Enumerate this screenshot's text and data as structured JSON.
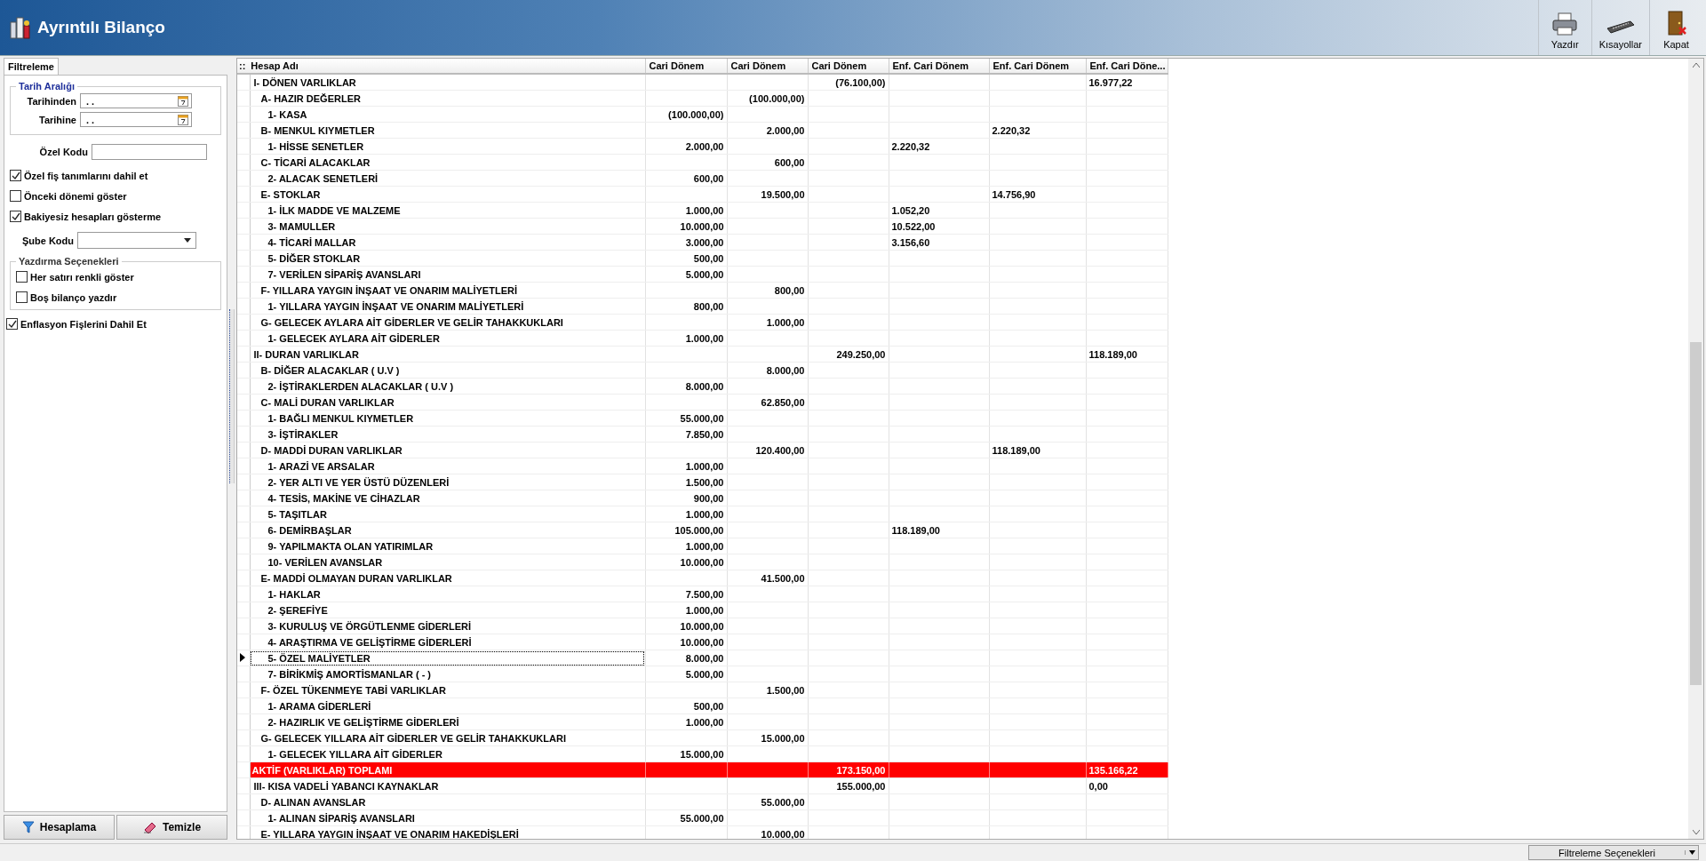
{
  "window": {
    "title": "Ayrıntılı Bilanço"
  },
  "toolbar": [
    {
      "label": "Yazdır",
      "kind": "print"
    },
    {
      "label": "Kısayollar",
      "kind": "keyboard"
    },
    {
      "label": "Kapat",
      "kind": "close"
    }
  ],
  "filter_panel": {
    "tab": "Filtreleme",
    "date_group": {
      "title": "Tarih Aralığı",
      "fields": [
        {
          "label": "Tarihinden",
          "value": ". ."
        },
        {
          "label": "Tarihine",
          "value": ". ."
        }
      ]
    },
    "special_code": {
      "label": "Özel Kodu"
    },
    "options": [
      {
        "label": "Özel fiş tanımlarını dahil et",
        "checked": true
      },
      {
        "label": "Önceki dönemi göster",
        "checked": false
      },
      {
        "label": "Bakiyesiz hesapları gösterme",
        "checked": true
      }
    ],
    "branch_code": {
      "label": "Şube Kodu"
    },
    "print_group": {
      "title": "Yazdırma Seçenekleri",
      "options": [
        {
          "label": "Her satırı renkli göster",
          "checked": false
        },
        {
          "label": "Boş bilanço yazdır",
          "checked": false
        }
      ]
    },
    "inflation": {
      "label": "Enflasyon Fişlerini Dahil Et",
      "checked": true
    },
    "buttons": [
      {
        "label": "Hesaplama",
        "kind": "filter"
      },
      {
        "label": "Temizle",
        "kind": "eraser"
      }
    ]
  },
  "table": {
    "corner": "::",
    "name_column": "Hesap Adı",
    "columns": [
      "Cari Dönem",
      "Cari Dönem",
      "Cari Dönem",
      "Enf. Cari Dönem",
      "Enf. Cari Dönem",
      "Enf. Cari Döne..."
    ],
    "rows": [
      {
        "name": "I-  DÖNEN VARLIKLAR",
        "kind": "section",
        "selected": false,
        "cells": [
          null,
          null,
          "(76.100,00)",
          null,
          null,
          "16.977,22"
        ]
      },
      {
        "name": "A- HAZIR DEĞERLER",
        "kind": "group",
        "selected": false,
        "cells": [
          null,
          "(100.000,00)",
          null,
          null,
          null,
          null
        ]
      },
      {
        "name": "1- KASA",
        "kind": "item",
        "selected": false,
        "cells": [
          "(100.000,00)",
          null,
          null,
          null,
          null,
          null
        ]
      },
      {
        "name": "B- MENKUL KIYMETLER",
        "kind": "group",
        "selected": false,
        "cells": [
          null,
          "2.000,00",
          null,
          null,
          "2.220,32",
          null
        ]
      },
      {
        "name": "1- HİSSE SENETLER",
        "kind": "item",
        "selected": false,
        "cells": [
          "2.000,00",
          null,
          null,
          "2.220,32",
          null,
          null
        ]
      },
      {
        "name": "C- TİCARİ ALACAKLAR",
        "kind": "group",
        "selected": false,
        "cells": [
          null,
          "600,00",
          null,
          null,
          null,
          null
        ]
      },
      {
        "name": "2- ALACAK SENETLERİ",
        "kind": "item",
        "selected": false,
        "cells": [
          "600,00",
          null,
          null,
          null,
          null,
          null
        ]
      },
      {
        "name": "E- STOKLAR",
        "kind": "group",
        "selected": false,
        "cells": [
          null,
          "19.500,00",
          null,
          null,
          "14.756,90",
          null
        ]
      },
      {
        "name": "1- İLK MADDE VE MALZEME",
        "kind": "item",
        "selected": false,
        "cells": [
          "1.000,00",
          null,
          null,
          "1.052,20",
          null,
          null
        ]
      },
      {
        "name": "3- MAMULLER",
        "kind": "item",
        "selected": false,
        "cells": [
          "10.000,00",
          null,
          null,
          "10.522,00",
          null,
          null
        ]
      },
      {
        "name": "4- TİCARİ MALLAR",
        "kind": "item",
        "selected": false,
        "cells": [
          "3.000,00",
          null,
          null,
          "3.156,60",
          null,
          null
        ]
      },
      {
        "name": "5- DİĞER STOKLAR",
        "kind": "item",
        "selected": false,
        "cells": [
          "500,00",
          null,
          null,
          null,
          null,
          null
        ]
      },
      {
        "name": "7- VERİLEN SİPARİŞ AVANSLARI",
        "kind": "item",
        "selected": false,
        "cells": [
          "5.000,00",
          null,
          null,
          null,
          null,
          null
        ]
      },
      {
        "name": "F- YILLARA YAYGIN İNŞAAT VE ONARIM MALİYETLERİ",
        "kind": "group",
        "selected": false,
        "cells": [
          null,
          "800,00",
          null,
          null,
          null,
          null
        ]
      },
      {
        "name": "1- YILLARA YAYGIN İNŞAAT VE ONARIM MALİYETLERİ",
        "kind": "item",
        "selected": false,
        "cells": [
          "800,00",
          null,
          null,
          null,
          null,
          null
        ]
      },
      {
        "name": "G- GELECEK AYLARA AİT GİDERLER VE GELİR TAHAKKUKLARI",
        "kind": "group",
        "selected": false,
        "cells": [
          null,
          "1.000,00",
          null,
          null,
          null,
          null
        ]
      },
      {
        "name": "1- GELECEK AYLARA AİT GİDERLER",
        "kind": "item",
        "selected": false,
        "cells": [
          "1.000,00",
          null,
          null,
          null,
          null,
          null
        ]
      },
      {
        "name": "II-  DURAN VARLIKLAR",
        "kind": "section",
        "selected": false,
        "cells": [
          null,
          null,
          "249.250,00",
          null,
          null,
          "118.189,00"
        ]
      },
      {
        "name": "B- DİĞER ALACAKLAR  ( U.V )",
        "kind": "group",
        "selected": false,
        "cells": [
          null,
          "8.000,00",
          null,
          null,
          null,
          null
        ]
      },
      {
        "name": "2- İŞTİRAKLERDEN ALACAKLAR  ( U.V )",
        "kind": "item",
        "selected": false,
        "cells": [
          "8.000,00",
          null,
          null,
          null,
          null,
          null
        ]
      },
      {
        "name": "C- MALİ DURAN VARLIKLAR",
        "kind": "group",
        "selected": false,
        "cells": [
          null,
          "62.850,00",
          null,
          null,
          null,
          null
        ]
      },
      {
        "name": "1- BAĞLI MENKUL KIYMETLER",
        "kind": "item",
        "selected": false,
        "cells": [
          "55.000,00",
          null,
          null,
          null,
          null,
          null
        ]
      },
      {
        "name": "3- İŞTİRAKLER",
        "kind": "item",
        "selected": false,
        "cells": [
          "7.850,00",
          null,
          null,
          null,
          null,
          null
        ]
      },
      {
        "name": "D- MADDİ DURAN VARLIKLAR",
        "kind": "group",
        "selected": false,
        "cells": [
          null,
          "120.400,00",
          null,
          null,
          "118.189,00",
          null
        ]
      },
      {
        "name": "1- ARAZİ VE ARSALAR",
        "kind": "item",
        "selected": false,
        "cells": [
          "1.000,00",
          null,
          null,
          null,
          null,
          null
        ]
      },
      {
        "name": "2- YER ALTI VE YER ÜSTÜ DÜZENLERİ",
        "kind": "item",
        "selected": false,
        "cells": [
          "1.500,00",
          null,
          null,
          null,
          null,
          null
        ]
      },
      {
        "name": "4- TESİS, MAKİNE VE CİHAZLAR",
        "kind": "item",
        "selected": false,
        "cells": [
          "900,00",
          null,
          null,
          null,
          null,
          null
        ]
      },
      {
        "name": "5- TAŞITLAR",
        "kind": "item",
        "selected": false,
        "cells": [
          "1.000,00",
          null,
          null,
          null,
          null,
          null
        ]
      },
      {
        "name": "6- DEMİRBAŞLAR",
        "kind": "item",
        "selected": false,
        "cells": [
          "105.000,00",
          null,
          null,
          "118.189,00",
          null,
          null
        ]
      },
      {
        "name": "9- YAPILMAKTA OLAN YATIRIMLAR",
        "kind": "item",
        "selected": false,
        "cells": [
          "1.000,00",
          null,
          null,
          null,
          null,
          null
        ]
      },
      {
        "name": "10- VERİLEN AVANSLAR",
        "kind": "item",
        "selected": false,
        "cells": [
          "10.000,00",
          null,
          null,
          null,
          null,
          null
        ]
      },
      {
        "name": "E- MADDİ OLMAYAN DURAN VARLIKLAR",
        "kind": "group",
        "selected": false,
        "cells": [
          null,
          "41.500,00",
          null,
          null,
          null,
          null
        ]
      },
      {
        "name": "1- HAKLAR",
        "kind": "item",
        "selected": false,
        "cells": [
          "7.500,00",
          null,
          null,
          null,
          null,
          null
        ]
      },
      {
        "name": "2- ŞEREFİYE",
        "kind": "item",
        "selected": false,
        "cells": [
          "1.000,00",
          null,
          null,
          null,
          null,
          null
        ]
      },
      {
        "name": "3- KURULUŞ VE ÖRGÜTLENME GİDERLERİ",
        "kind": "item",
        "selected": false,
        "cells": [
          "10.000,00",
          null,
          null,
          null,
          null,
          null
        ]
      },
      {
        "name": "4- ARAŞTIRMA VE GELİŞTİRME GİDERLERİ",
        "kind": "item",
        "selected": false,
        "cells": [
          "10.000,00",
          null,
          null,
          null,
          null,
          null
        ]
      },
      {
        "name": "5- ÖZEL MALİYETLER",
        "kind": "item",
        "selected": true,
        "cells": [
          "8.000,00",
          null,
          null,
          null,
          null,
          null
        ]
      },
      {
        "name": "7- BİRİKMİŞ AMORTİSMANLAR ( - )",
        "kind": "item",
        "selected": false,
        "cells": [
          "5.000,00",
          null,
          null,
          null,
          null,
          null
        ]
      },
      {
        "name": "F- ÖZEL TÜKENMEYE TABİ VARLIKLAR",
        "kind": "group",
        "selected": false,
        "cells": [
          null,
          "1.500,00",
          null,
          null,
          null,
          null
        ]
      },
      {
        "name": "1- ARAMA GİDERLERİ",
        "kind": "item",
        "selected": false,
        "cells": [
          "500,00",
          null,
          null,
          null,
          null,
          null
        ]
      },
      {
        "name": "2- HAZIRLIK VE GELİŞTİRME GİDERLERİ",
        "kind": "item",
        "selected": false,
        "cells": [
          "1.000,00",
          null,
          null,
          null,
          null,
          null
        ]
      },
      {
        "name": "G- GELECEK YILLARA AİT GİDERLER VE GELİR TAHAKKUKLARI",
        "kind": "group",
        "selected": false,
        "cells": [
          null,
          "15.000,00",
          null,
          null,
          null,
          null
        ]
      },
      {
        "name": "1- GELECEK YILLARA AİT GİDERLER",
        "kind": "item",
        "selected": false,
        "cells": [
          "15.000,00",
          null,
          null,
          null,
          null,
          null
        ]
      },
      {
        "name": "AKTİF (VARLIKLAR) TOPLAMI",
        "kind": "total",
        "selected": false,
        "cells": [
          null,
          null,
          "173.150,00",
          null,
          null,
          "135.166,22"
        ]
      },
      {
        "name": "III-   KISA VADELİ YABANCI KAYNAKLAR",
        "kind": "section",
        "selected": false,
        "cells": [
          null,
          null,
          "155.000,00",
          null,
          null,
          "0,00"
        ]
      },
      {
        "name": "D- ALINAN AVANSLAR",
        "kind": "group",
        "selected": false,
        "cells": [
          null,
          "55.000,00",
          null,
          null,
          null,
          null
        ]
      },
      {
        "name": "1- ALINAN SİPARİŞ AVANSLARI",
        "kind": "item",
        "selected": false,
        "cells": [
          "55.000,00",
          null,
          null,
          null,
          null,
          null
        ]
      },
      {
        "name": "E- YILLARA YAYGIN İNŞAAT VE ONARIM HAKEDİŞLERİ",
        "kind": "group",
        "selected": false,
        "cells": [
          null,
          "10.000,00",
          null,
          null,
          null,
          null
        ]
      }
    ]
  },
  "status_bar": {
    "dropdown": "Filtreleme Seçenekleri"
  }
}
